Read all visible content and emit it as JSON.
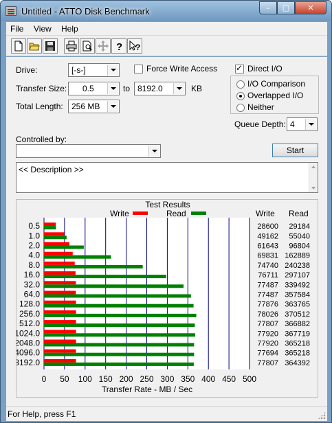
{
  "window": {
    "title": "Untitled - ATTO Disk Benchmark",
    "buttons": {
      "minimize": "–",
      "maximize": "□",
      "close": "✕"
    }
  },
  "menu": [
    "File",
    "View",
    "Help"
  ],
  "toolbar_icons": [
    "new-icon",
    "open-icon",
    "save-icon",
    "print-icon",
    "print-preview-icon",
    "move-icon",
    "help-icon",
    "context-help-icon"
  ],
  "form": {
    "drive_label": "Drive:",
    "drive_value": "[-s-]",
    "transfer_size_label": "Transfer Size:",
    "transfer_from": "0.5",
    "to_label": "to",
    "transfer_to": "8192.0",
    "kb_label": "KB",
    "total_length_label": "Total Length:",
    "total_length_value": "256 MB",
    "force_write_label": "Force Write Access",
    "force_write_checked": false,
    "direct_io_label": "Direct I/O",
    "direct_io_checked": true,
    "io_options": [
      {
        "label": "I/O Comparison",
        "selected": false
      },
      {
        "label": "Overlapped I/O",
        "selected": true
      },
      {
        "label": "Neither",
        "selected": false
      }
    ],
    "queue_depth_label": "Queue Depth:",
    "queue_depth_value": "4",
    "controlled_by_label": "Controlled by:",
    "controlled_by_value": "",
    "start_label": "Start",
    "description": "<< Description >>"
  },
  "colors": {
    "write": "#ff0000",
    "read": "#008000",
    "grid": "#000080"
  },
  "results": {
    "title": "Test Results",
    "write_legend": "Write",
    "read_legend": "Read",
    "write_header": "Write",
    "read_header": "Read"
  },
  "chart_data": {
    "type": "bar",
    "title": "Test Results",
    "xlabel": "Transfer Rate - MB / Sec",
    "ylabel": "",
    "xlim": [
      0,
      500
    ],
    "x_ticks": [
      "0",
      "50",
      "100",
      "150",
      "200",
      "250",
      "300",
      "350",
      "400",
      "450",
      "500"
    ],
    "categories": [
      "0.5",
      "1.0",
      "2.0",
      "4.0",
      "8.0",
      "16.0",
      "32.0",
      "64.0",
      "128.0",
      "256.0",
      "512.0",
      "1024.0",
      "2048.0",
      "4096.0",
      "8192.0"
    ],
    "series": [
      {
        "name": "Write",
        "values": [
          28600,
          49162,
          61643,
          69831,
          74740,
          76711,
          77487,
          77487,
          77876,
          78026,
          77807,
          77920,
          77920,
          77694,
          77807
        ]
      },
      {
        "name": "Read",
        "values": [
          29184,
          55040,
          96804,
          162889,
          240238,
          297107,
          339492,
          357584,
          363765,
          370512,
          366882,
          367719,
          365218,
          365218,
          364392
        ]
      }
    ],
    "bar_mb_per_sec": {
      "write": [
        28.6,
        49.2,
        61.6,
        69.8,
        74.7,
        76.7,
        77.5,
        77.5,
        77.9,
        78.0,
        77.8,
        77.9,
        77.9,
        77.7,
        77.8
      ],
      "read": [
        29.2,
        55.0,
        96.8,
        162.9,
        240.2,
        297.1,
        339.5,
        357.6,
        363.8,
        370.5,
        366.9,
        367.7,
        365.2,
        365.2,
        364.4
      ]
    },
    "grid": true,
    "legend": "top"
  },
  "status": "For Help, press F1"
}
